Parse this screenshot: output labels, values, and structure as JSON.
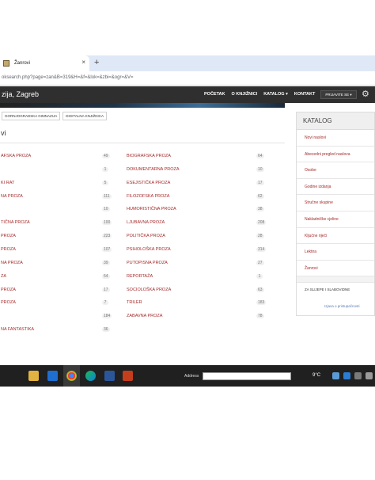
{
  "browser": {
    "tab_title": "Žanrovi",
    "tab_close": "×",
    "new_tab": "+",
    "address": "oksearch.php?page=zan&B=319&H=&f=&lok=&zbi=&ogr=&V="
  },
  "site": {
    "title": "zija, Zagreb",
    "nav": [
      "POČETAK",
      "O KNJIŽNICI",
      "KATALOG ▾",
      "KONTAKT"
    ],
    "login": "PRIJAVITE SE ▾"
  },
  "breadcrumbs": [
    "GORNJOGRADSKA GIMNAZIJA",
    "DIGITALNA KNJIŽNICA"
  ],
  "page_heading": "vi",
  "genres_left": [
    {
      "label": "AFSKA PROZA",
      "count": "49"
    },
    {
      "label": "",
      "count": "1"
    },
    {
      "label": "KI RAT",
      "count": "5"
    },
    {
      "label": "NA PROZA",
      "count": "111"
    },
    {
      "label": "",
      "count": "10"
    },
    {
      "label": "TIČNA PROZA",
      "count": "100"
    },
    {
      "label": "PROZA",
      "count": "223"
    },
    {
      "label": "PROZA",
      "count": "107"
    },
    {
      "label": "NA PROZA",
      "count": "39"
    },
    {
      "label": "ZA",
      "count": "54"
    },
    {
      "label": "PROZA",
      "count": "17"
    },
    {
      "label": "PROZA",
      "count": "7"
    },
    {
      "label": "",
      "count": "184"
    },
    {
      "label": "NA FANTASTIKA",
      "count": "36"
    }
  ],
  "genres_right": [
    {
      "label": "BIOGRAFSKA PROZA",
      "count": "64"
    },
    {
      "label": "DOKUMENTARNA PROZA",
      "count": "10"
    },
    {
      "label": "ESEJISTIČKA PROZA",
      "count": "17"
    },
    {
      "label": "FILOZOFSKA PROZA",
      "count": "62"
    },
    {
      "label": "HUMORISTIČNA PROZA",
      "count": "38"
    },
    {
      "label": "LJUBAVNA PROZA",
      "count": "208"
    },
    {
      "label": "POLITIČKA PROZA",
      "count": "28"
    },
    {
      "label": "PSIHOLOŠKA PROZA",
      "count": "314"
    },
    {
      "label": "PUTOPISNA PROZA",
      "count": "27"
    },
    {
      "label": "REPORTAŽA",
      "count": "1"
    },
    {
      "label": "SOCIOLOŠKA PROZA",
      "count": "63"
    },
    {
      "label": "TRILER",
      "count": "183"
    },
    {
      "label": "ZABAVNA PROZA",
      "count": "78"
    }
  ],
  "sidebar": {
    "heading": "KATALOG",
    "items": [
      "Novi naslovi",
      "Abecedni pregled naslova",
      "Osobe",
      "Godine izdanja",
      "Stručne skupine",
      "Nakladničke cjeline",
      "Ključne riječi",
      "Lektira",
      "Žanrovi"
    ],
    "bottom": "ZA SLIJEPE I SLABOVIDNE",
    "help": "Izjava o pristupačnosti"
  },
  "taskbar": {
    "address_label": "Address",
    "tray_text": "9°C"
  }
}
